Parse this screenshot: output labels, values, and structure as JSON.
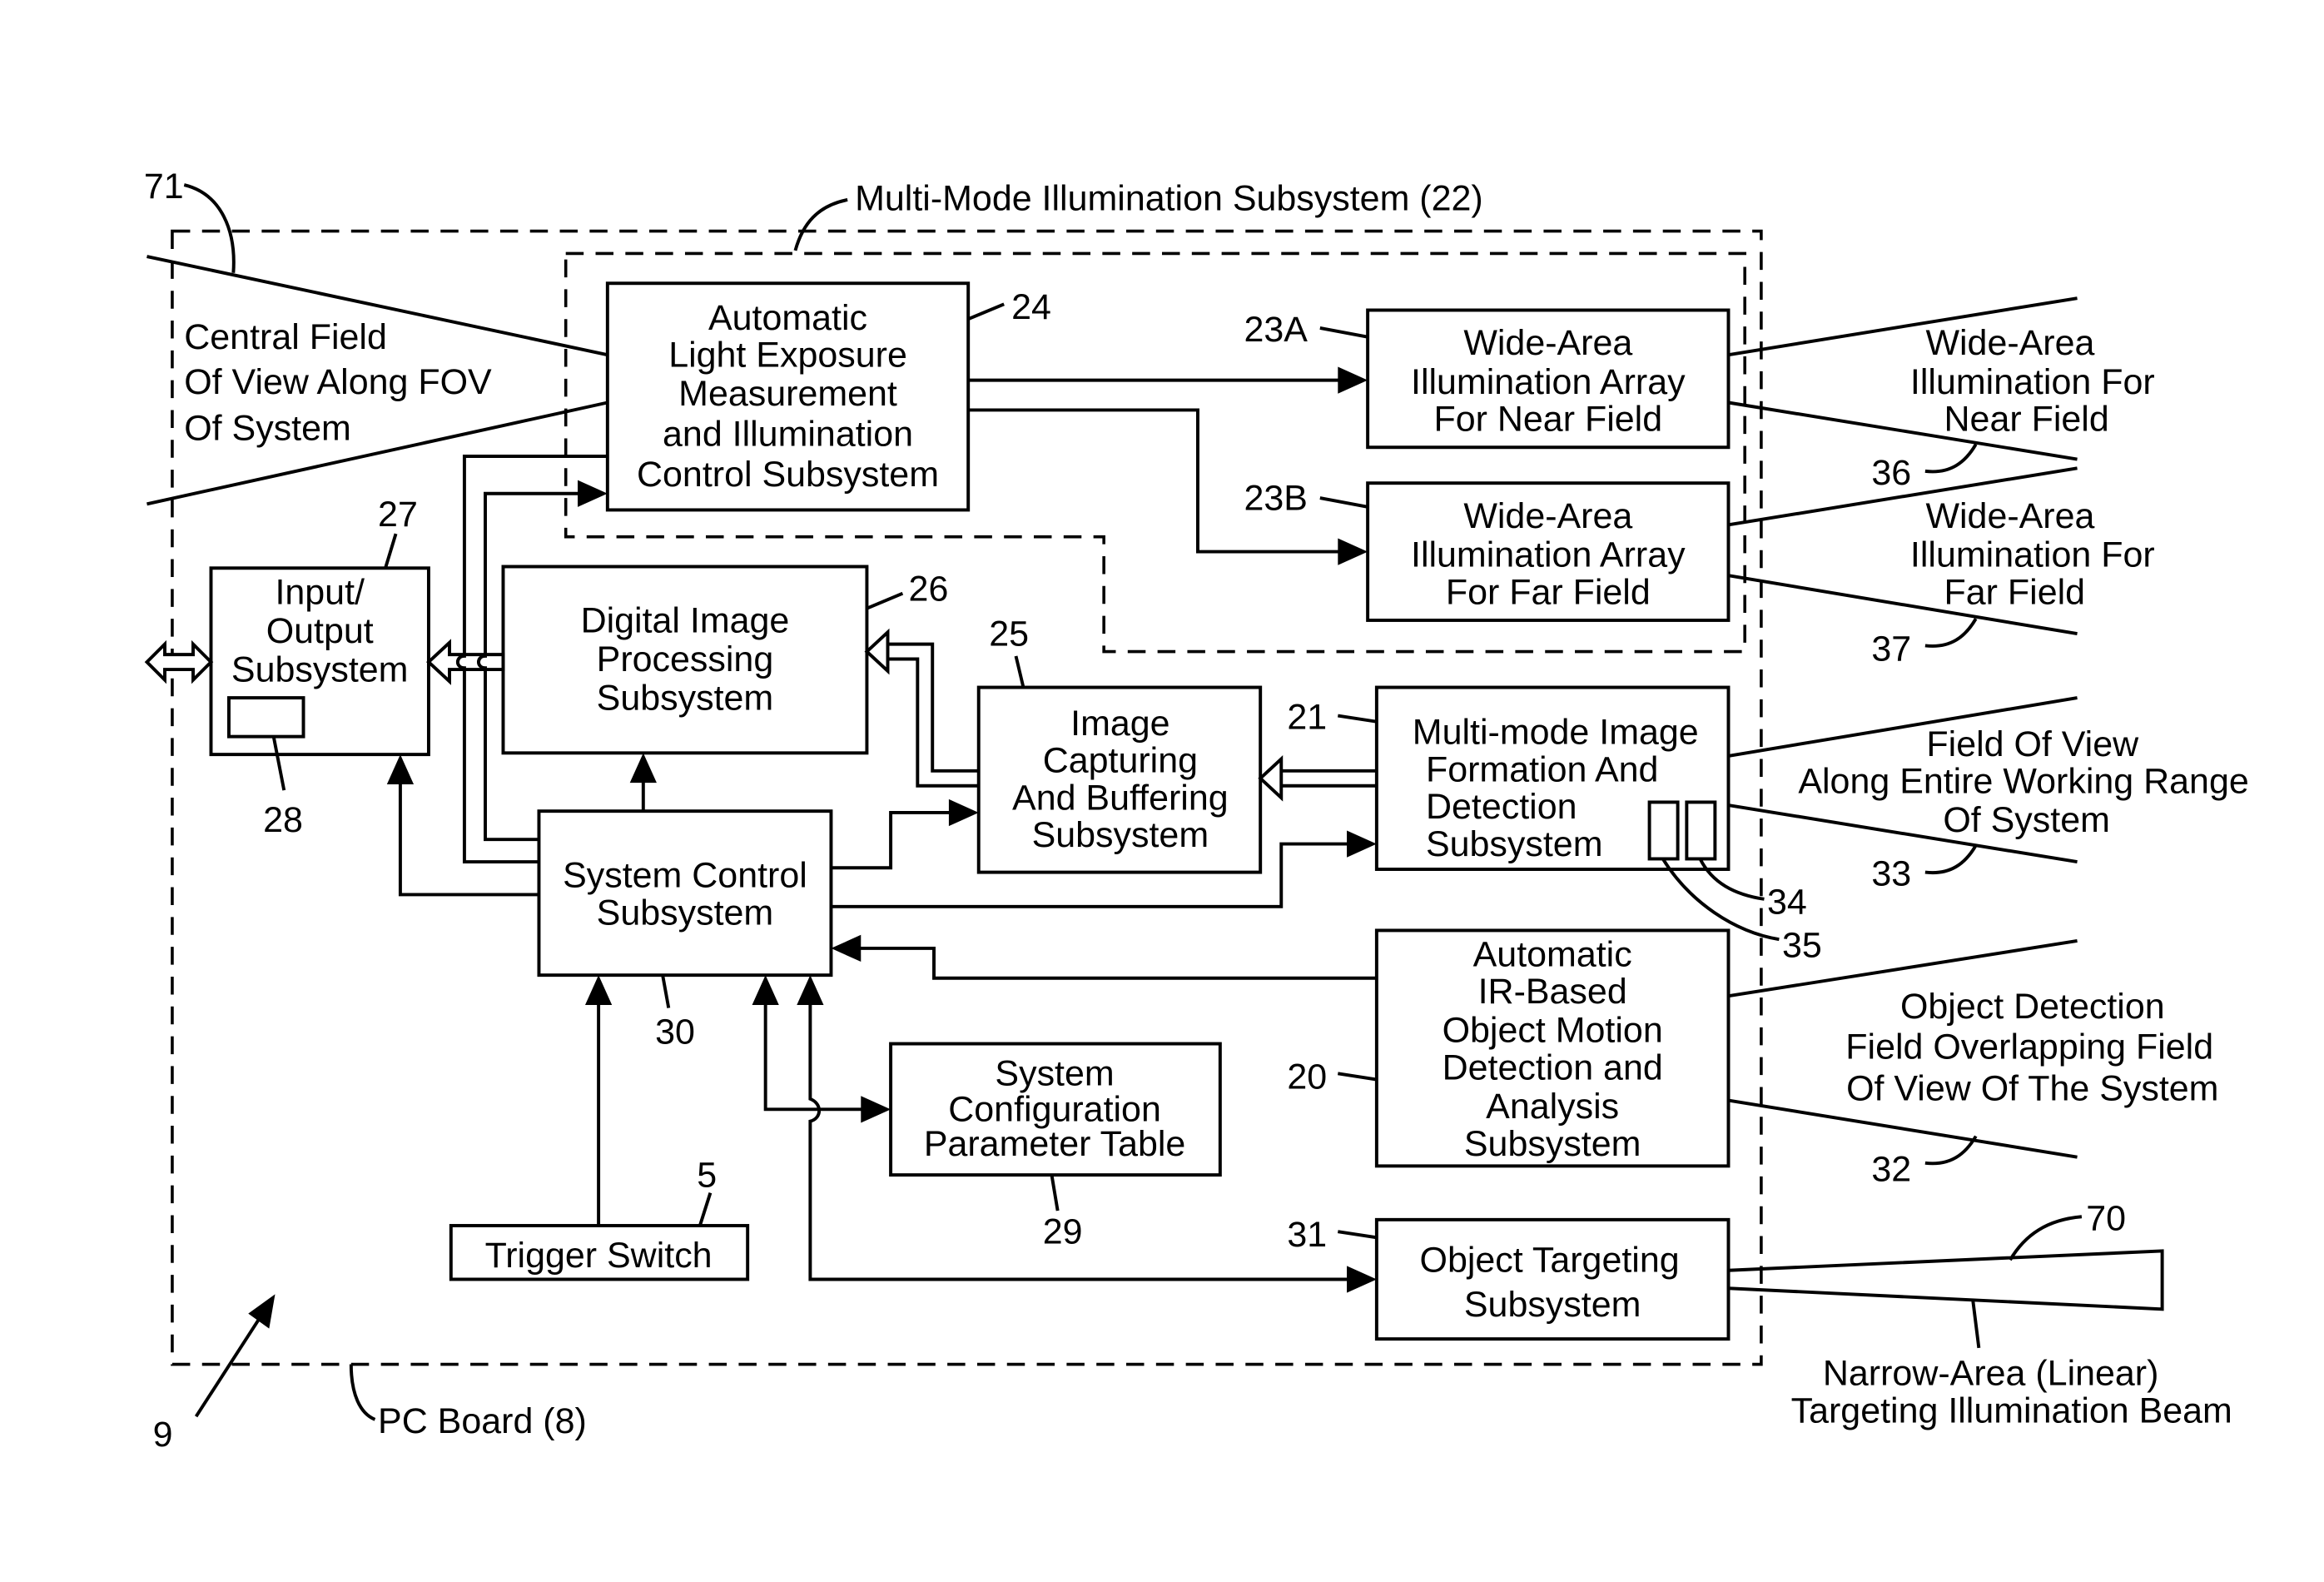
{
  "diagram": {
    "regions": {
      "pc_board": "PC Board (8)",
      "illumination": "Multi-Mode Illumination Subsystem (22)"
    },
    "blocks": {
      "auto_light": {
        "ref": "24",
        "lines": [
          "Automatic",
          "Light Exposure",
          "Measurement",
          "and Illumination",
          "Control Subsystem"
        ]
      },
      "near_array": {
        "ref": "23A",
        "lines": [
          "Wide-Area",
          "Illumination Array",
          "For Near Field"
        ]
      },
      "far_array": {
        "ref": "23B",
        "lines": [
          "Wide-Area",
          "Illumination Array",
          "For Far Field"
        ]
      },
      "io": {
        "ref": "27",
        "sub_ref": "28",
        "lines": [
          "Input/",
          "Output",
          "Subsystem"
        ]
      },
      "dip": {
        "ref": "26",
        "lines": [
          "Digital Image",
          "Processing",
          "Subsystem"
        ]
      },
      "capture": {
        "ref": "25",
        "lines": [
          "Image",
          "Capturing",
          "And Buffering",
          "Subsystem"
        ]
      },
      "formation": {
        "ref": "21",
        "sub_refs": [
          "34",
          "35"
        ],
        "lines": [
          "Multi-mode Image",
          "Formation And",
          "Detection",
          "Subsystem"
        ]
      },
      "control": {
        "ref": "30",
        "lines": [
          "System Control",
          "Subsystem"
        ]
      },
      "ir_detect": {
        "ref": "20",
        "lines": [
          "Automatic",
          "IR-Based",
          "Object Motion",
          "Detection and",
          "Analysis",
          "Subsystem"
        ]
      },
      "config": {
        "ref": "29",
        "lines": [
          "System",
          "Configuration",
          "Parameter Table"
        ]
      },
      "trigger": {
        "ref": "5",
        "lines": [
          "Trigger Switch"
        ]
      },
      "targeting": {
        "ref": "31",
        "lines": [
          "Object Targeting",
          "Subsystem"
        ]
      }
    },
    "fields": {
      "central": {
        "ref": "71",
        "lines": [
          "Central Field",
          "Of View Along FOV",
          "Of System"
        ]
      },
      "near": {
        "ref": "36",
        "lines": [
          "Wide-Area",
          "Illumination For",
          "Near Field"
        ]
      },
      "far": {
        "ref": "37",
        "lines": [
          "Wide-Area",
          "Illumination For",
          "Far Field"
        ]
      },
      "fov": {
        "ref": "33",
        "lines": [
          "Field Of View",
          "Along Entire Working Range",
          "Of System"
        ]
      },
      "detection": {
        "ref": "32",
        "lines": [
          "Object Detection",
          "Field Overlapping Field",
          "Of View Of The System"
        ]
      },
      "beam": {
        "ref": "70",
        "lines": [
          "Narrow-Area (Linear)",
          "Targeting Illumination Beam"
        ]
      }
    },
    "device_ref": "9"
  }
}
